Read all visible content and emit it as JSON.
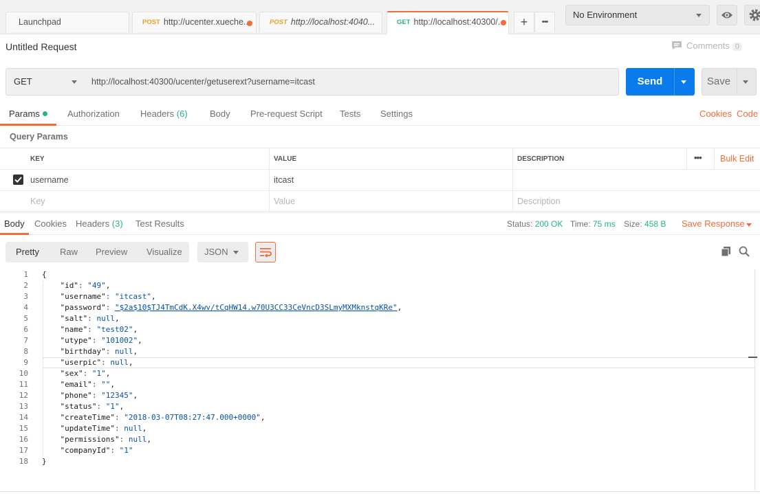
{
  "tabs": [
    {
      "method": "",
      "label": "Launchpad",
      "unsaved": false
    },
    {
      "method": "POST",
      "label": "http://ucenter.xueche...",
      "unsaved": true
    },
    {
      "method": "POST",
      "label": "http://localhost:4040...",
      "unsaved": false
    },
    {
      "method": "GET",
      "label": "http://localhost:40300/...",
      "unsaved": true
    }
  ],
  "tab_actions": {
    "add": "+",
    "more": "•••"
  },
  "environment": {
    "selected": "No Environment"
  },
  "request": {
    "title": "Untitled Request",
    "comments_label": "Comments",
    "comments_count": "0",
    "method": "GET",
    "url": "http://localhost:40300/ucenter/getuserext?username=itcast",
    "send_label": "Send",
    "save_label": "Save"
  },
  "request_tabs": {
    "params": "Params",
    "authorization": "Authorization",
    "headers": "Headers",
    "headers_count": "(6)",
    "body": "Body",
    "prerequest": "Pre-request Script",
    "tests": "Tests",
    "settings": "Settings",
    "cookies": "Cookies",
    "code": "Code"
  },
  "query_params": {
    "title": "Query Params",
    "headers": {
      "key": "KEY",
      "value": "VALUE",
      "description": "DESCRIPTION"
    },
    "more": "•••",
    "bulk_edit": "Bulk Edit",
    "rows": [
      {
        "key": "username",
        "value": "itcast",
        "description": "",
        "checked": true
      }
    ],
    "placeholder": {
      "key": "Key",
      "value": "Value",
      "description": "Description"
    }
  },
  "response_tabs": {
    "body": "Body",
    "cookies": "Cookies",
    "headers": "Headers",
    "headers_count": "(3)",
    "test_results": "Test Results"
  },
  "response_status": {
    "status_label": "Status:",
    "status": "200 OK",
    "time_label": "Time:",
    "time": "75 ms",
    "size_label": "Size:",
    "size": "458 B",
    "save_response": "Save Response"
  },
  "view_modes": {
    "pretty": "Pretty",
    "raw": "Raw",
    "preview": "Preview",
    "visualize": "Visualize",
    "format": "JSON"
  },
  "code_lines": [
    {
      "n": "1",
      "k": "",
      "v": "",
      "open": "{"
    },
    {
      "n": "2",
      "k": "\"id\"",
      "v": "\"49\"",
      "vt": "str"
    },
    {
      "n": "3",
      "k": "\"username\"",
      "v": "\"itcast\"",
      "vt": "str"
    },
    {
      "n": "4",
      "k": "\"password\"",
      "v": "\"$2a$10$TJ4TmCdK.X4wv/tCqHW14.w70U3CC33CeVncD3SLmyMXMknstqKRe\"",
      "vt": "str"
    },
    {
      "n": "5",
      "k": "\"salt\"",
      "v": "null",
      "vt": "kw"
    },
    {
      "n": "6",
      "k": "\"name\"",
      "v": "\"test02\"",
      "vt": "str"
    },
    {
      "n": "7",
      "k": "\"utype\"",
      "v": "\"101002\"",
      "vt": "str"
    },
    {
      "n": "8",
      "k": "\"birthday\"",
      "v": "null",
      "vt": "kw"
    },
    {
      "n": "9",
      "k": "\"userpic\"",
      "v": "null",
      "vt": "kw"
    },
    {
      "n": "10",
      "k": "\"sex\"",
      "v": "\"1\"",
      "vt": "str"
    },
    {
      "n": "11",
      "k": "\"email\"",
      "v": "\"\"",
      "vt": "str"
    },
    {
      "n": "12",
      "k": "\"phone\"",
      "v": "\"12345\"",
      "vt": "str"
    },
    {
      "n": "13",
      "k": "\"status\"",
      "v": "\"1\"",
      "vt": "str"
    },
    {
      "n": "14",
      "k": "\"createTime\"",
      "v": "\"2018-03-07T08:27:47.000+0000\"",
      "vt": "str"
    },
    {
      "n": "15",
      "k": "\"updateTime\"",
      "v": "null",
      "vt": "kw"
    },
    {
      "n": "16",
      "k": "\"permissions\"",
      "v": "null",
      "vt": "kw"
    },
    {
      "n": "17",
      "k": "\"companyId\"",
      "v": "\"1\"",
      "vt": "str",
      "last": true
    },
    {
      "n": "18",
      "k": "",
      "v": "",
      "open": "}"
    }
  ],
  "colors": {
    "accent": "#f26b3a",
    "primary": "#097bed",
    "success": "#26b47f"
  }
}
